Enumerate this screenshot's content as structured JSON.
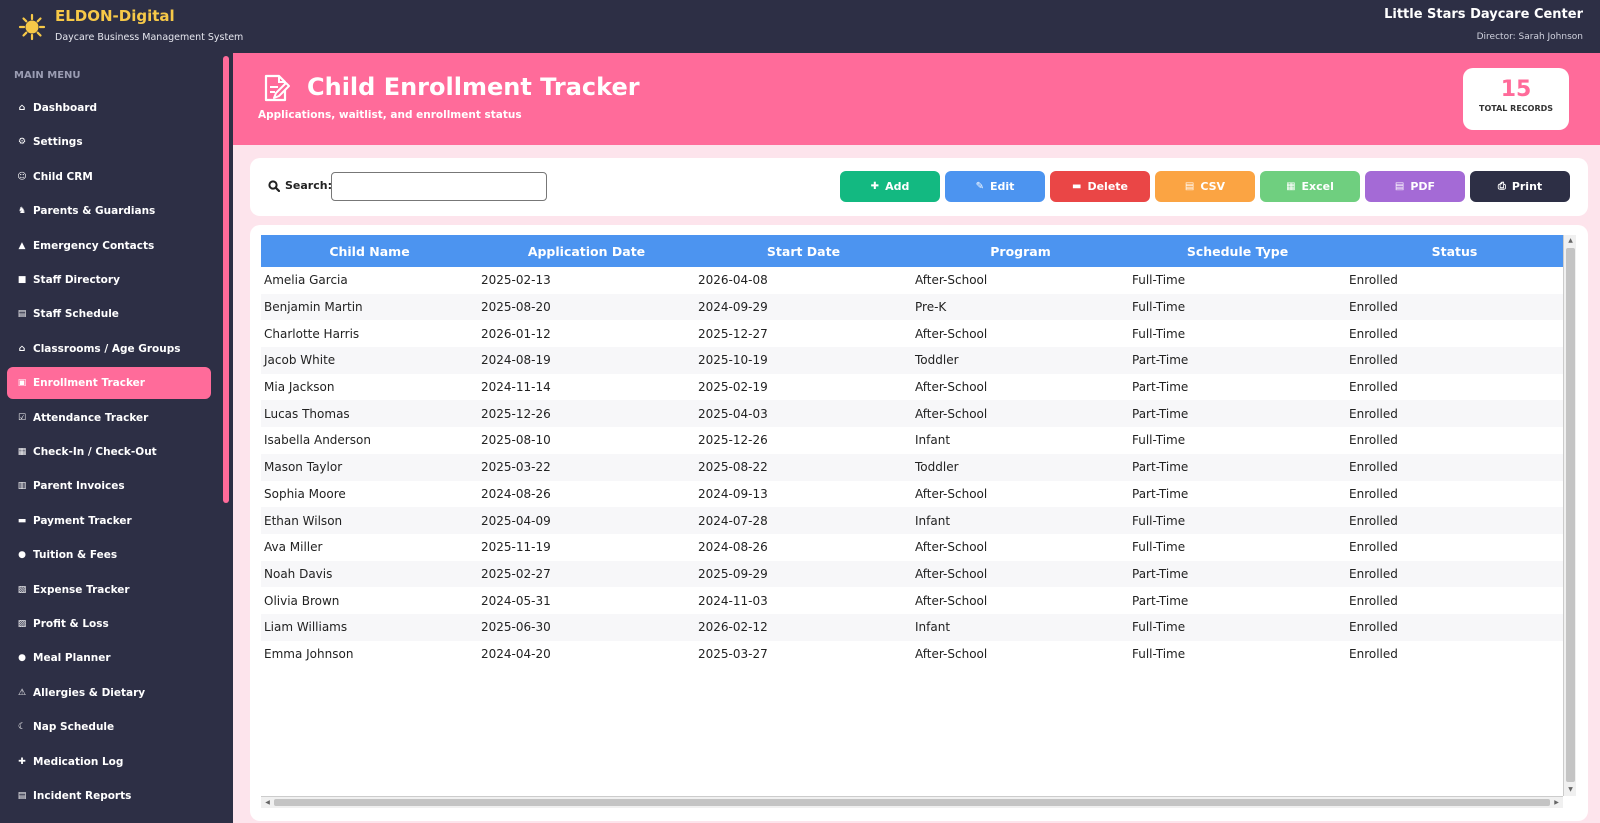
{
  "app": {
    "brand": "ELDON-Digital",
    "subtitle": "Daycare Business Management System",
    "center_name": "Little Stars Daycare Center",
    "director": "Director: Sarah Johnson"
  },
  "colors": {
    "navy": "#2d2f45",
    "pink": "#ff6b9a",
    "brand_yellow": "#f7c948",
    "table_header_blue": "#4c94f0"
  },
  "sidebar": {
    "heading": "MAIN MENU",
    "items": [
      {
        "label": "Dashboard",
        "icon": "home-icon",
        "glyph": "⌂"
      },
      {
        "label": "Settings",
        "icon": "gear-icon",
        "glyph": "⚙"
      },
      {
        "label": "Child CRM",
        "icon": "child-icon",
        "glyph": "☺"
      },
      {
        "label": "Parents & Guardians",
        "icon": "family-icon",
        "glyph": "♞"
      },
      {
        "label": "Emergency Contacts",
        "icon": "siren-icon",
        "glyph": "▲"
      },
      {
        "label": "Staff Directory",
        "icon": "directory-icon",
        "glyph": "■"
      },
      {
        "label": "Staff Schedule",
        "icon": "calendar-icon",
        "glyph": "▤"
      },
      {
        "label": "Classrooms / Age Groups",
        "icon": "school-icon",
        "glyph": "⌂"
      },
      {
        "label": "Enrollment Tracker",
        "icon": "document-icon",
        "glyph": "▣"
      },
      {
        "label": "Attendance Tracker",
        "icon": "checkbox-icon",
        "glyph": "☑"
      },
      {
        "label": "Check-In / Check-Out",
        "icon": "door-icon",
        "glyph": "▦"
      },
      {
        "label": "Parent Invoices",
        "icon": "invoice-icon",
        "glyph": "▥"
      },
      {
        "label": "Payment Tracker",
        "icon": "card-icon",
        "glyph": "▬"
      },
      {
        "label": "Tuition & Fees",
        "icon": "money-bag-icon",
        "glyph": "●"
      },
      {
        "label": "Expense Tracker",
        "icon": "receipt-icon",
        "glyph": "▧"
      },
      {
        "label": "Profit & Loss",
        "icon": "chart-icon",
        "glyph": "▨"
      },
      {
        "label": "Meal Planner",
        "icon": "meal-icon",
        "glyph": "●"
      },
      {
        "label": "Allergies & Dietary",
        "icon": "warning-icon",
        "glyph": "⚠"
      },
      {
        "label": "Nap Schedule",
        "icon": "sleep-icon",
        "glyph": "☾"
      },
      {
        "label": "Medication Log",
        "icon": "pill-icon",
        "glyph": "✚"
      },
      {
        "label": "Incident Reports",
        "icon": "report-icon",
        "glyph": "▤"
      }
    ]
  },
  "header": {
    "title": "Child Enrollment Tracker",
    "subtitle": "Applications, waitlist, and enrollment status",
    "records_count": "15",
    "records_label": "TOTAL RECORDS"
  },
  "toolbar": {
    "search_label": "Search:",
    "search_value": "",
    "buttons": {
      "add": "Add",
      "edit": "Edit",
      "delete": "Delete",
      "csv": "CSV",
      "excel": "Excel",
      "pdf": "PDF",
      "print": "Print"
    }
  },
  "table": {
    "columns": [
      "Child Name",
      "Application Date",
      "Start Date",
      "Program",
      "Schedule Type",
      "Status"
    ],
    "rows": [
      [
        "Amelia Garcia",
        "2025-02-13",
        "2026-04-08",
        "After-School",
        "Full-Time",
        "Enrolled"
      ],
      [
        "Benjamin Martin",
        "2025-08-20",
        "2024-09-29",
        "Pre-K",
        "Full-Time",
        "Enrolled"
      ],
      [
        "Charlotte Harris",
        "2026-01-12",
        "2025-12-27",
        "After-School",
        "Full-Time",
        "Enrolled"
      ],
      [
        "Jacob White",
        "2024-08-19",
        "2025-10-19",
        "Toddler",
        "Part-Time",
        "Enrolled"
      ],
      [
        "Mia Jackson",
        "2024-11-14",
        "2025-02-19",
        "After-School",
        "Part-Time",
        "Enrolled"
      ],
      [
        "Lucas Thomas",
        "2025-12-26",
        "2025-04-03",
        "After-School",
        "Part-Time",
        "Enrolled"
      ],
      [
        "Isabella Anderson",
        "2025-08-10",
        "2025-12-26",
        "Infant",
        "Full-Time",
        "Enrolled"
      ],
      [
        "Mason Taylor",
        "2025-03-22",
        "2025-08-22",
        "Toddler",
        "Part-Time",
        "Enrolled"
      ],
      [
        "Sophia Moore",
        "2024-08-26",
        "2024-09-13",
        "After-School",
        "Part-Time",
        "Enrolled"
      ],
      [
        "Ethan Wilson",
        "2025-04-09",
        "2024-07-28",
        "Infant",
        "Full-Time",
        "Enrolled"
      ],
      [
        "Ava Miller",
        "2025-11-19",
        "2024-08-26",
        "After-School",
        "Full-Time",
        "Enrolled"
      ],
      [
        "Noah Davis",
        "2025-02-27",
        "2025-09-29",
        "After-School",
        "Part-Time",
        "Enrolled"
      ],
      [
        "Olivia Brown",
        "2024-05-31",
        "2024-11-03",
        "After-School",
        "Part-Time",
        "Enrolled"
      ],
      [
        "Liam Williams",
        "2025-06-30",
        "2026-02-12",
        "Infant",
        "Full-Time",
        "Enrolled"
      ],
      [
        "Emma Johnson",
        "2024-04-20",
        "2025-03-27",
        "After-School",
        "Full-Time",
        "Enrolled"
      ]
    ]
  }
}
